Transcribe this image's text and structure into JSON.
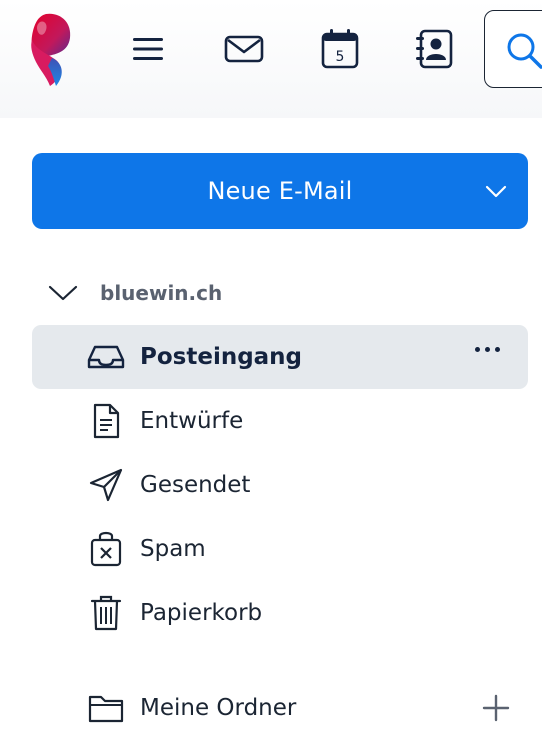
{
  "header": {
    "icons": [
      "swisscom-logo",
      "hamburger-menu-icon",
      "mail-icon",
      "calendar-icon",
      "contacts-icon",
      "search-icon"
    ],
    "calendar_day": "5"
  },
  "compose": {
    "label": "Neue E-Mail"
  },
  "account": {
    "name": "bluewin.ch"
  },
  "folders": [
    {
      "label": "Posteingang",
      "icon": "inbox-icon",
      "active": true
    },
    {
      "label": "Entwürfe",
      "icon": "document-icon"
    },
    {
      "label": "Gesendet",
      "icon": "send-icon"
    },
    {
      "label": "Spam",
      "icon": "spam-icon"
    },
    {
      "label": "Papierkorb",
      "icon": "trash-icon"
    }
  ],
  "my_folders": {
    "label": "Meine Ordner",
    "icon": "folder-icon"
  },
  "colors": {
    "primary": "#0e76e8",
    "active_bg": "#e5e9ed",
    "text": "#1b2533"
  }
}
